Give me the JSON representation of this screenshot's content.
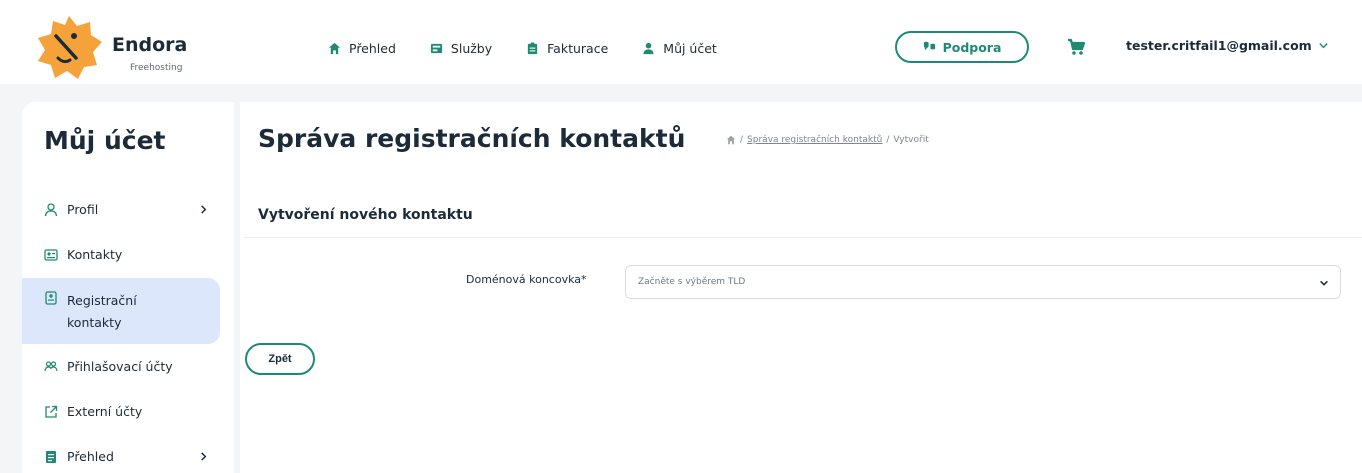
{
  "brand": {
    "name": "Endora",
    "subtitle": "Freehosting"
  },
  "nav": [
    {
      "label": "Přehled",
      "icon": "home-icon"
    },
    {
      "label": "Služby",
      "icon": "services-icon"
    },
    {
      "label": "Fakturace",
      "icon": "invoice-icon"
    },
    {
      "label": "Můj účet",
      "icon": "user-icon"
    }
  ],
  "header": {
    "support_label": "Podpora",
    "user_email": "tester.critfail1@gmail.com"
  },
  "sidebar": {
    "title": "Můj účet",
    "items": [
      {
        "label": "Profil",
        "icon": "person-icon",
        "has_chevron": true
      },
      {
        "label": "Kontakty",
        "icon": "contact-card-icon"
      },
      {
        "label": "Registrační kontakty",
        "icon": "registration-icon",
        "active": true
      },
      {
        "label": "Přihlašovací účty",
        "icon": "accounts-icon"
      },
      {
        "label": "Externí účty",
        "icon": "external-link-icon"
      },
      {
        "label": "Přehled",
        "icon": "overview-icon",
        "has_chevron": true
      }
    ]
  },
  "main": {
    "title": "Správa registračních kontaktů",
    "breadcrumb": {
      "link": "Správa registračních kontaktů",
      "current": "Vytvořit"
    },
    "section_title": "Vytvoření nového kontaktu",
    "field_label": "Doménová koncovka*",
    "select_placeholder": "Začněte s výběrem TLD",
    "back_label": "Zpět"
  },
  "colors": {
    "accent": "#1e8a74",
    "active_bg": "#dde7fb",
    "logo": "#f6a23a"
  }
}
